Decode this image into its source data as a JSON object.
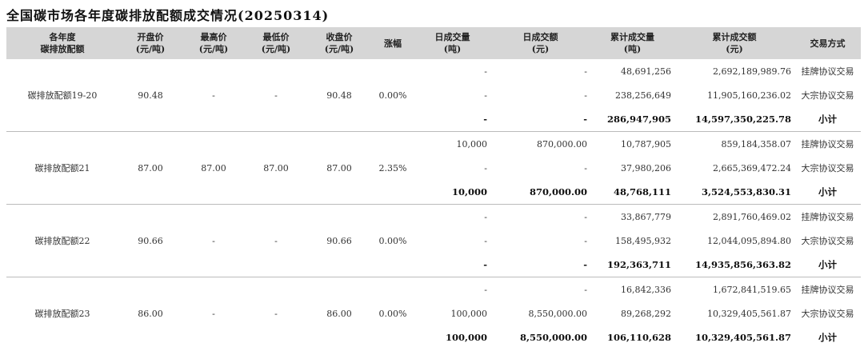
{
  "title": "全国碳市场各年度碳排放配额成交情况(20250314)",
  "headers": [
    "各年度\n碳排放配额",
    "开盘价\n(元/吨)",
    "最高价\n(元/吨)",
    "最低价\n(元/吨)",
    "收盘价\n(元/吨)",
    "涨幅",
    "日成交量\n(吨)",
    "日成交额\n(元)",
    "累计成交量\n(吨)",
    "累计成交额\n(元)",
    "交易方式"
  ],
  "groups": [
    {
      "name": "碳排放配额19-20",
      "open": "90.48",
      "high": "-",
      "low": "-",
      "close": "90.48",
      "change": "0.00%",
      "rows": [
        {
          "vol": "-",
          "amt": "-",
          "cum_vol": "48,691,256",
          "cum_amt": "2,692,189,989.76",
          "method": "挂牌协议交易"
        },
        {
          "vol": "-",
          "amt": "-",
          "cum_vol": "238,256,649",
          "cum_amt": "11,905,160,236.02",
          "method": "大宗协议交易"
        },
        {
          "vol": "-",
          "amt": "-",
          "cum_vol": "286,947,905",
          "cum_amt": "14,597,350,225.78",
          "method": "小计"
        }
      ]
    },
    {
      "name": "碳排放配额21",
      "open": "87.00",
      "high": "87.00",
      "low": "87.00",
      "close": "87.00",
      "change": "2.35%",
      "rows": [
        {
          "vol": "10,000",
          "amt": "870,000.00",
          "cum_vol": "10,787,905",
          "cum_amt": "859,184,358.07",
          "method": "挂牌协议交易"
        },
        {
          "vol": "-",
          "amt": "-",
          "cum_vol": "37,980,206",
          "cum_amt": "2,665,369,472.24",
          "method": "大宗协议交易"
        },
        {
          "vol": "10,000",
          "amt": "870,000.00",
          "cum_vol": "48,768,111",
          "cum_amt": "3,524,553,830.31",
          "method": "小计"
        }
      ]
    },
    {
      "name": "碳排放配额22",
      "open": "90.66",
      "high": "-",
      "low": "-",
      "close": "90.66",
      "change": "0.00%",
      "rows": [
        {
          "vol": "-",
          "amt": "-",
          "cum_vol": "33,867,779",
          "cum_amt": "2,891,760,469.02",
          "method": "挂牌协议交易"
        },
        {
          "vol": "-",
          "amt": "-",
          "cum_vol": "158,495,932",
          "cum_amt": "12,044,095,894.80",
          "method": "大宗协议交易"
        },
        {
          "vol": "-",
          "amt": "-",
          "cum_vol": "192,363,711",
          "cum_amt": "14,935,856,363.82",
          "method": "小计"
        }
      ]
    },
    {
      "name": "碳排放配额23",
      "open": "86.00",
      "high": "-",
      "low": "-",
      "close": "86.00",
      "change": "0.00%",
      "rows": [
        {
          "vol": "-",
          "amt": "-",
          "cum_vol": "16,842,336",
          "cum_amt": "1,672,841,519.65",
          "method": "挂牌协议交易"
        },
        {
          "vol": "100,000",
          "amt": "8,550,000.00",
          "cum_vol": "89,268,292",
          "cum_amt": "10,329,405,561.87",
          "method": "大宗协议交易"
        },
        {
          "vol": "100,000",
          "amt": "8,550,000.00",
          "cum_vol": "106,110,628",
          "cum_amt": "10,329,405,561.87",
          "method": "小计"
        }
      ]
    }
  ]
}
